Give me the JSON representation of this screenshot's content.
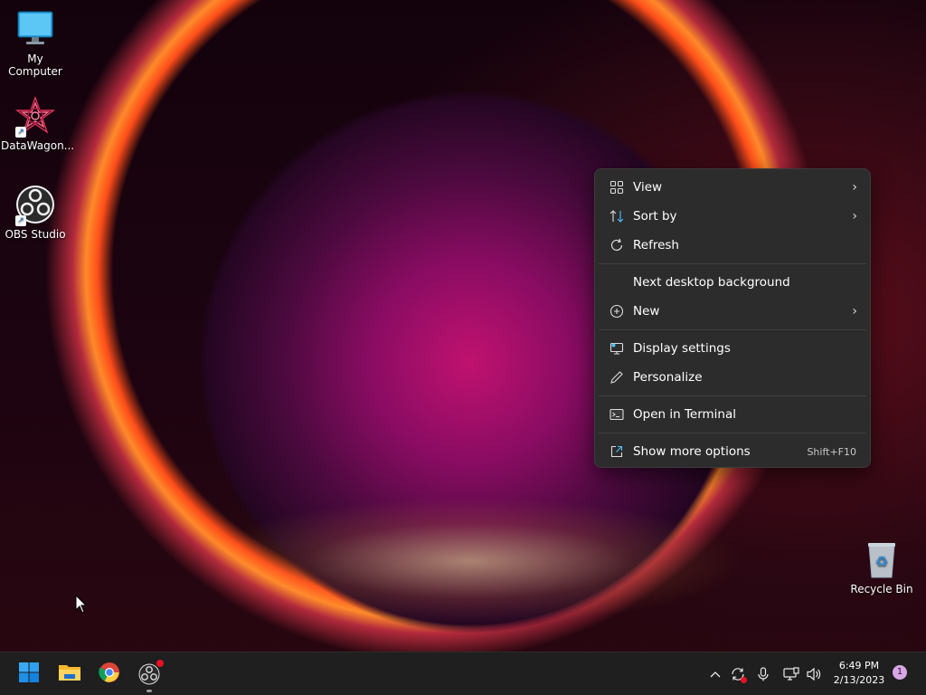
{
  "desktop": {
    "icons": [
      {
        "label": "My Computer"
      },
      {
        "label": "DataWagon..."
      },
      {
        "label": "OBS Studio"
      },
      {
        "label": "Recycle Bin"
      }
    ]
  },
  "context_menu": {
    "view": {
      "label": "View",
      "icon": "grid-icon",
      "submenu": true
    },
    "sort_by": {
      "label": "Sort by",
      "icon": "sort-icon",
      "submenu": true
    },
    "refresh": {
      "label": "Refresh",
      "icon": "refresh-icon"
    },
    "next_background": {
      "label": "Next desktop background"
    },
    "new": {
      "label": "New",
      "icon": "plus-circle-icon",
      "submenu": true
    },
    "display_settings": {
      "label": "Display settings",
      "icon": "monitor-icon"
    },
    "personalize": {
      "label": "Personalize",
      "icon": "pen-icon"
    },
    "open_terminal": {
      "label": "Open in Terminal",
      "icon": "terminal-icon"
    },
    "show_more": {
      "label": "Show more options",
      "icon": "share-icon",
      "shortcut": "Shift+F10"
    }
  },
  "taskbar": {
    "apps": [
      {
        "name": "Start",
        "icon": "windows-logo-icon"
      },
      {
        "name": "File Explorer",
        "icon": "folder-icon"
      },
      {
        "name": "Google Chrome",
        "icon": "chrome-icon"
      },
      {
        "name": "OBS Studio",
        "icon": "obs-icon"
      }
    ],
    "tray": {
      "time": "6:49 PM",
      "date": "2/13/2023",
      "notification_count": "1"
    }
  },
  "colors": {
    "menu_bg": "#2c2c2c",
    "taskbar_bg": "#1f1f1f",
    "accent_blue": "#4cc2ff"
  }
}
